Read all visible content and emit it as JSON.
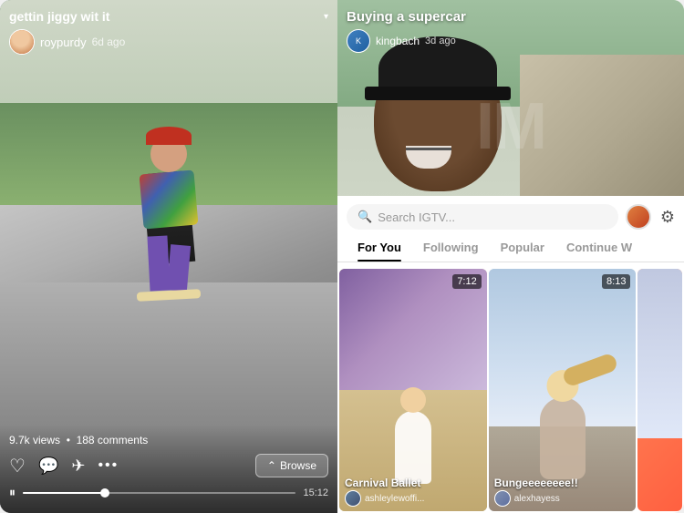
{
  "left": {
    "title": "gettin jiggy wit it",
    "user": "roypurdy",
    "time_ago": "6d ago",
    "views": "9.7k views",
    "comments": "188 comments",
    "browse_label": "Browse",
    "duration": "15:12",
    "progress_pct": 30
  },
  "right": {
    "title": "Buying a supercar",
    "user": "kingbach",
    "time_ago": "3d ago",
    "search_placeholder": "Search IGTV...",
    "tabs": [
      {
        "label": "For You",
        "active": true
      },
      {
        "label": "Following",
        "active": false
      },
      {
        "label": "Popular",
        "active": false
      },
      {
        "label": "Continue W",
        "active": false
      }
    ],
    "videos": [
      {
        "title": "Carnival Ballet",
        "username": "ashleylewoffi...",
        "duration": "7:12"
      },
      {
        "title": "Bungeeeeeeee!!",
        "username": "alexhayess",
        "duration": "8:13"
      }
    ]
  },
  "icons": {
    "chevron": "▾",
    "play": "▶",
    "pause": "⏸",
    "heart": "♡",
    "comment": "💬",
    "send": "✈",
    "dots": "•••",
    "search": "🔍",
    "settings": "⚙",
    "browse_arrow": "⌃"
  }
}
